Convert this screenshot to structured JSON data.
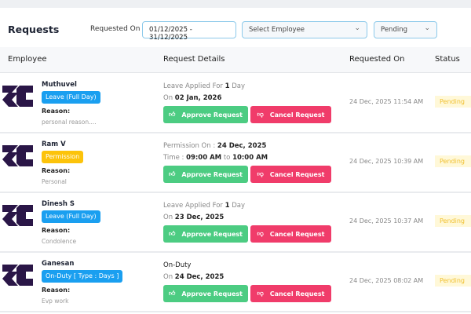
{
  "header": {
    "title": "Requests",
    "filter_label": "Requested On",
    "date_range": "01/12/2025 - 31/12/2025",
    "employee_placeholder": "Select Employee",
    "status_value": "Pending"
  },
  "table": {
    "columns": [
      "Employee",
      "Request Details",
      "Requested On",
      "Status"
    ]
  },
  "buttons": {
    "approve": "Approve Request",
    "cancel": "Cancel Request"
  },
  "colors": {
    "approve": "#4ccc82",
    "cancel": "#f03c6a",
    "leave_badge": "#1a9ff0",
    "permission_badge": "#fcc30a",
    "logo": "#2a1647"
  },
  "rows": [
    {
      "name": "Muthuvel",
      "type": "Leave (Full Day)",
      "reason_label": "Reason:",
      "reason": "personal reason....",
      "l1a": "Leave Applied For ",
      "l1b": "1",
      "l1c": " Day",
      "l2a": "On ",
      "l2b": "02 Jan, 2026",
      "requested_on": "24 Dec, 2025 11:54 AM",
      "status": "Pending"
    },
    {
      "name": "Ram V",
      "type": "Permission",
      "reason_label": "Reason:",
      "reason": "Personal",
      "l1a": "Permission On : ",
      "l1b": "24 Dec, 2025",
      "l1c": "",
      "l2a": "Time : ",
      "l2b": "09:00 AM",
      "l2c": " to ",
      "l2d": "10:00 AM",
      "requested_on": "24 Dec, 2025 10:39 AM",
      "status": "Pending"
    },
    {
      "name": "Dinesh S",
      "type": "Leave (Full Day)",
      "reason_label": "Reason:",
      "reason": "Condolence",
      "l1a": "Leave Applied For ",
      "l1b": "1",
      "l1c": " Day",
      "l2a": "On ",
      "l2b": "23 Dec, 2025",
      "requested_on": "24 Dec, 2025 10:37 AM",
      "status": "Pending"
    },
    {
      "name": "Ganesan",
      "type": "On-Duty [ Type : Days ]",
      "reason_label": "Reason:",
      "reason": "Evp work",
      "l1a": "On-Duty",
      "l1b": "",
      "l1c": "",
      "l2a": "On ",
      "l2b": "24 Dec, 2025",
      "requested_on": "24 Dec, 2025 08:02 AM",
      "status": "Pending"
    }
  ]
}
